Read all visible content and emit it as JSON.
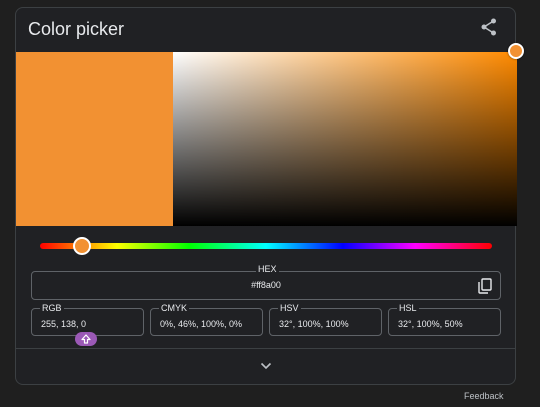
{
  "widget": {
    "title": "Color picker",
    "share_icon": "share-icon",
    "selected_color": "#f29132",
    "hue_color": "#ff8a00",
    "hue_fraction": 0.09
  },
  "hex": {
    "label": "HEX",
    "value": "#ff8a00",
    "copy_icon": "copy-icon"
  },
  "formats": [
    {
      "label": "RGB",
      "value": "255, 138, 0"
    },
    {
      "label": "CMYK",
      "value": "0%, 46%, 100%, 0%"
    },
    {
      "label": "HSV",
      "value": "32°, 100%, 100%"
    },
    {
      "label": "HSL",
      "value": "32°, 100%, 50%"
    }
  ],
  "badge": {
    "icon": "shift-up-icon",
    "color": "#9b59b6"
  },
  "footer": {
    "expand_icon": "chevron-down-icon",
    "feedback_label": "Feedback"
  }
}
